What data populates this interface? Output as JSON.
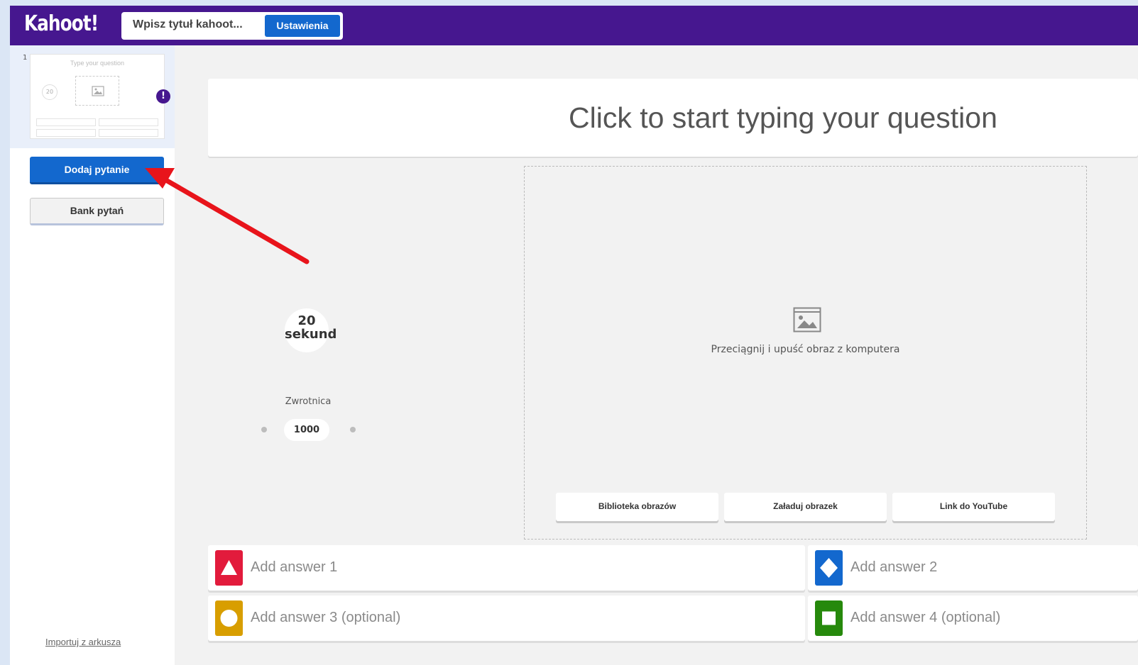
{
  "header": {
    "logo": "Kahoot!",
    "title_placeholder": "Wpisz tytuł kahoot...",
    "settings_label": "Ustawienia"
  },
  "sidebar": {
    "slide_number": "1",
    "thumb_question": "Type your question",
    "thumb_timer": "20",
    "warning_mark": "!",
    "add_question_label": "Dodaj pytanie",
    "question_bank_label": "Bank pytań",
    "import_label": "Importuj z arkusza"
  },
  "question": {
    "placeholder": "Click to start typing your question"
  },
  "timer": {
    "value": "20",
    "unit": "sekund"
  },
  "points": {
    "label": "Zwrotnica",
    "value": "1000"
  },
  "media": {
    "drop_text": "Przeciągnij i upuść obraz z komputera",
    "buttons": [
      "Biblioteka obrazów",
      "Załaduj obrazek",
      "Link do YouTube"
    ]
  },
  "answers": [
    {
      "placeholder": "Add answer 1",
      "shape": "triangle-icon",
      "color": "#e21b3c"
    },
    {
      "placeholder": "Add answer 2",
      "shape": "diamond-icon",
      "color": "#1368ce"
    },
    {
      "placeholder": "Add answer 3 (optional)",
      "shape": "circle-icon",
      "color": "#d89e00"
    },
    {
      "placeholder": "Add answer 4 (optional)",
      "shape": "square-icon",
      "color": "#26890c"
    }
  ],
  "theme": {
    "brand_purple": "#46178f",
    "primary_blue": "#1368ce",
    "annotation_arrow": "#e8141b"
  }
}
